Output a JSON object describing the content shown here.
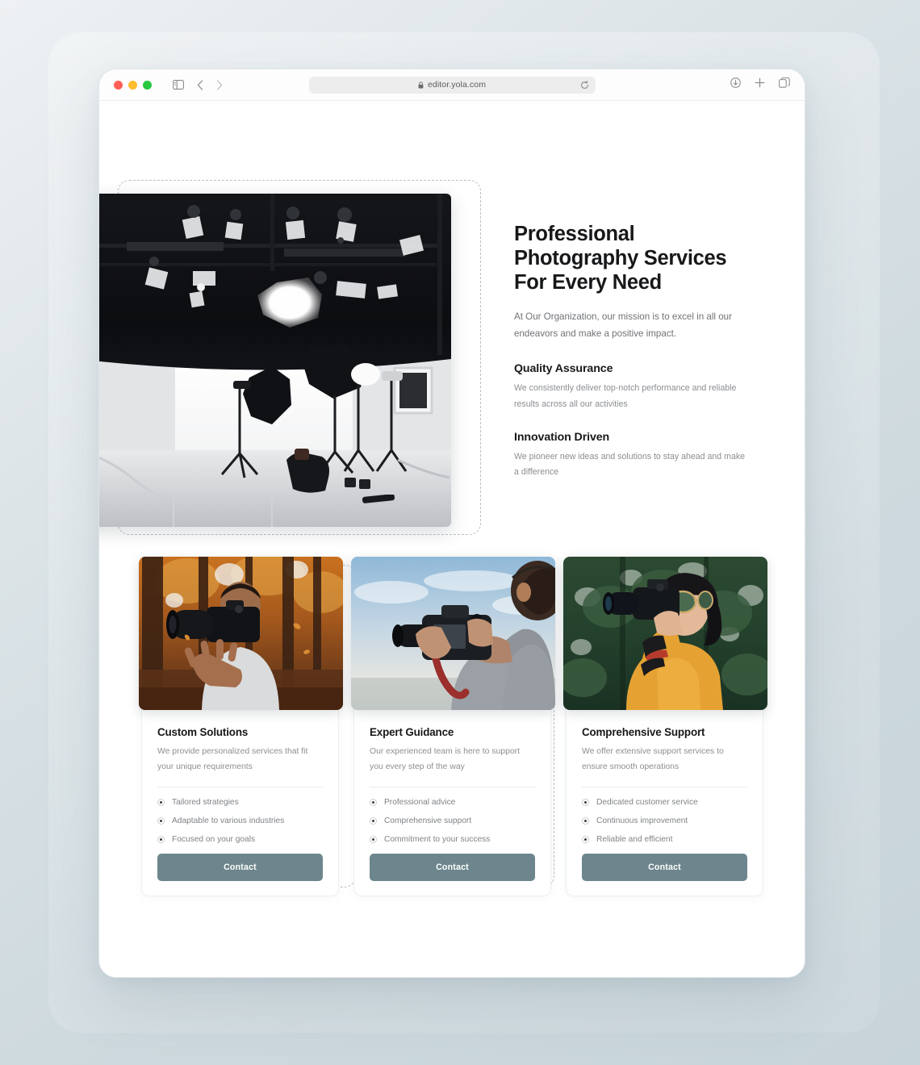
{
  "browser": {
    "url": "editor.yola.com",
    "traffic_lights": [
      "close-red",
      "minimize-yellow",
      "maximize-green"
    ],
    "icons": {
      "sidebar": "sidebar-toggle-icon",
      "back": "back-arrow-icon",
      "forward": "forward-arrow-icon",
      "shield": "privacy-shield-icon",
      "lock": "lock-icon",
      "reload": "reload-icon",
      "download": "download-icon",
      "new_tab": "plus-icon",
      "tabs": "copy-tabs-icon"
    }
  },
  "hero": {
    "title": "Professional Photography Services For Every Need",
    "subtitle": "At Our Organization, our mission is to excel in all our endeavors and make a positive impact.",
    "image_alt": "photography-studio-lighting",
    "features": [
      {
        "title": "Quality Assurance",
        "body": "We consistently deliver top-notch performance and reliable results across all our activities"
      },
      {
        "title": "Innovation Driven",
        "body": "We pioneer new ideas and solutions to stay ahead and make a difference"
      }
    ]
  },
  "cards": [
    {
      "title": "Custom Solutions",
      "desc": "We provide personalized services that fit your unique requirements",
      "image_alt": "photographer-tossing-camera-autumn-forest",
      "bullets": [
        "Tailored strategies",
        "Adaptable to various industries",
        "Focused on your goals"
      ],
      "button": "Contact"
    },
    {
      "title": "Expert Guidance",
      "desc": "Our experienced team is here to support you every step of the way",
      "image_alt": "photographer-holding-camera-sky",
      "bullets": [
        "Professional advice",
        "Comprehensive support",
        "Commitment to your success"
      ],
      "button": "Contact"
    },
    {
      "title": "Comprehensive Support",
      "desc": "We offer extensive support services to ensure smooth operations",
      "image_alt": "woman-photographer-yellow-sweater-trees",
      "bullets": [
        "Dedicated customer service",
        "Continuous improvement",
        "Reliable and efficient"
      ],
      "button": "Contact"
    }
  ],
  "colors": {
    "button": "#6d868d",
    "heading": "#17181a",
    "body_text": "#8b8e92",
    "page_bg": "#ffffff",
    "selection_dashed": "#b9c1c6"
  }
}
